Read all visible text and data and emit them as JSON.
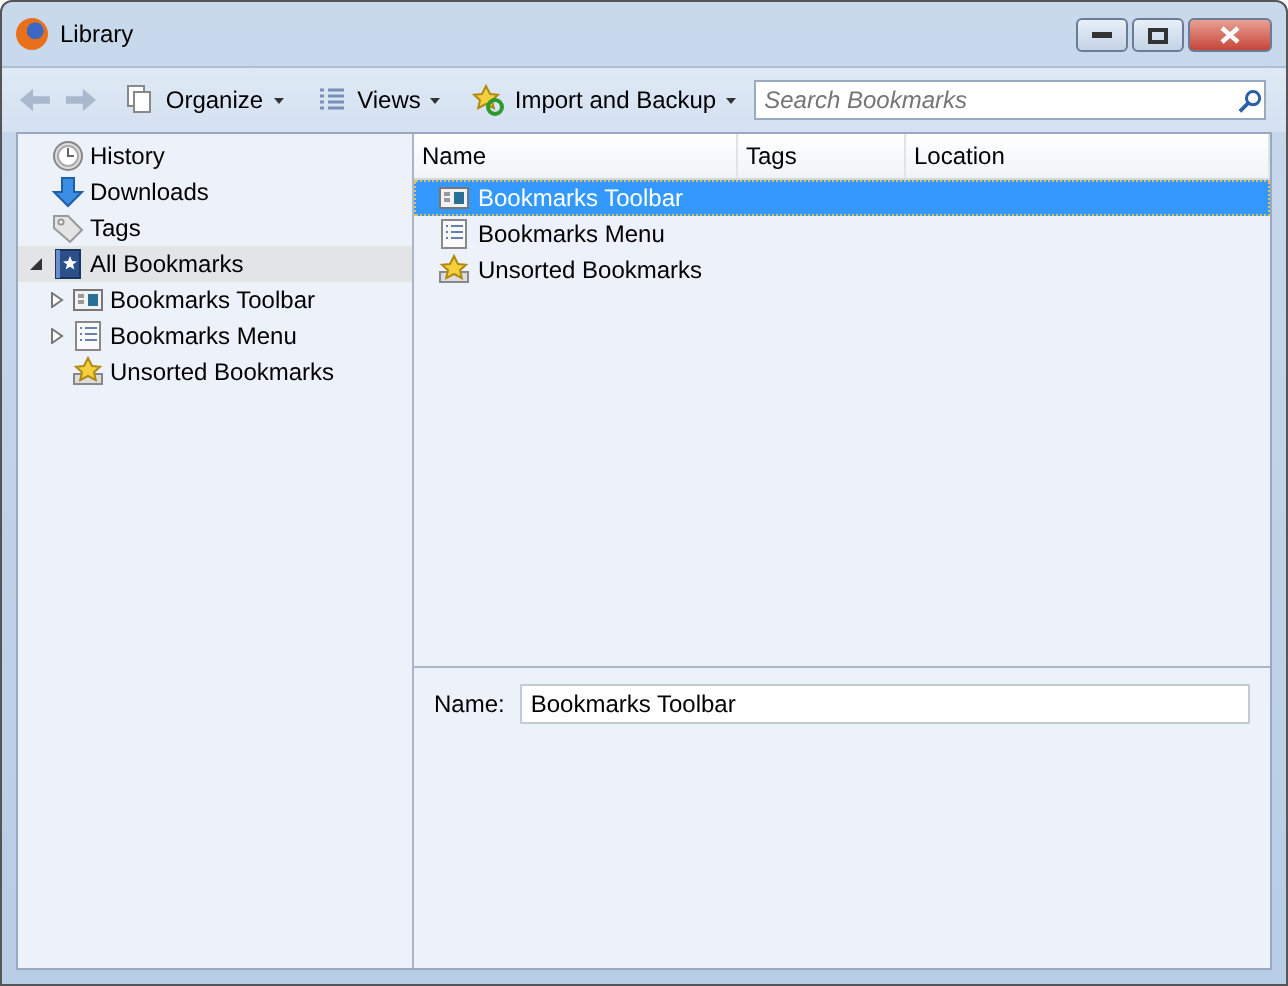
{
  "window": {
    "title": "Library"
  },
  "toolbar": {
    "items": [
      {
        "kind": "back",
        "disabled": true
      },
      {
        "kind": "forward",
        "disabled": true
      },
      {
        "kind": "organize",
        "label": "Organize"
      },
      {
        "kind": "views",
        "label": "Views"
      },
      {
        "kind": "import",
        "label": "Import and Backup"
      }
    ],
    "search": {
      "placeholder": "Search Bookmarks"
    }
  },
  "sidebar": {
    "items": [
      {
        "label": "History",
        "kind": "history",
        "selected": false
      },
      {
        "label": "Downloads",
        "kind": "downloads",
        "selected": false
      },
      {
        "label": "Tags",
        "kind": "tags",
        "selected": false
      },
      {
        "label": "All Bookmarks",
        "kind": "bookmarks",
        "selected": true,
        "expanded": true,
        "children": [
          {
            "label": "Bookmarks Toolbar",
            "kind": "toolbar",
            "selected": false,
            "expanded": false
          },
          {
            "label": "Bookmarks Menu",
            "kind": "menu",
            "selected": false,
            "expanded": false
          },
          {
            "label": "Unsorted Bookmarks",
            "kind": "unsorted",
            "selected": false
          }
        ]
      }
    ]
  },
  "table": {
    "columns": [
      "Name",
      "Tags",
      "Location"
    ],
    "rows": [
      {
        "name": "Bookmarks Toolbar",
        "kind": "toolbar",
        "selected": true
      },
      {
        "name": "Bookmarks Menu",
        "kind": "menu",
        "selected": false
      },
      {
        "name": "Unsorted Bookmarks",
        "kind": "unsorted",
        "selected": false
      }
    ]
  },
  "details": {
    "name_label": "Name:",
    "name_value": "Bookmarks Toolbar"
  }
}
